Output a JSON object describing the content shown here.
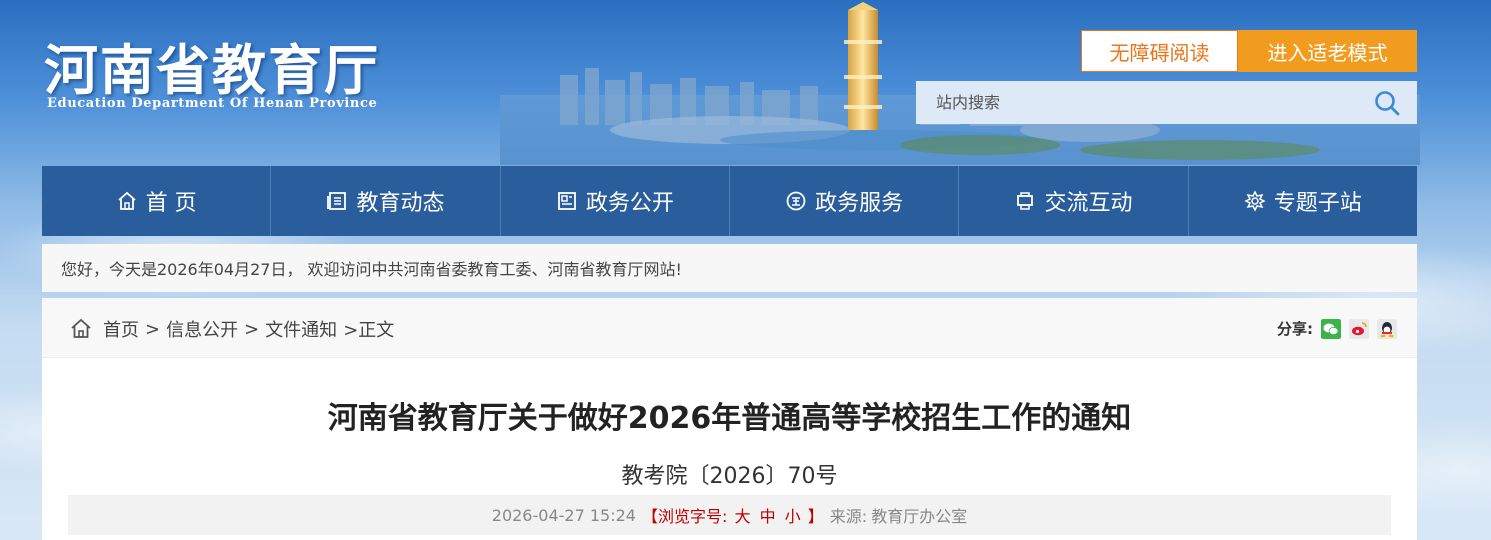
{
  "header": {
    "logo_cn": "河南省教育厅",
    "logo_en": "Education Department Of Henan Province",
    "btn_accessible": "无障碍阅读",
    "btn_elder": "进入适老模式",
    "search_placeholder": "站内搜索"
  },
  "nav": {
    "items": [
      {
        "label": "首 页",
        "icon": "home-icon"
      },
      {
        "label": "教育动态",
        "icon": "news-icon"
      },
      {
        "label": "政务公开",
        "icon": "document-icon"
      },
      {
        "label": "政务服务",
        "icon": "service-icon"
      },
      {
        "label": "交流互动",
        "icon": "interact-icon"
      },
      {
        "label": "专题子站",
        "icon": "subsite-icon"
      }
    ]
  },
  "welcome_text": "您好，今天是2026年04月27日， 欢迎访问中共河南省委教育工委、河南省教育厅网站!",
  "breadcrumb": {
    "home": "首页",
    "sep": ">",
    "level1": "信息公开",
    "level2": "文件通知",
    "current": ">正文"
  },
  "share_label": "分享:",
  "article": {
    "title": "河南省教育厅关于做好2026年普通高等学校招生工作的通知",
    "doc_number": "教考院〔2026〕70号",
    "datetime": "2026-04-27 15:24",
    "font_size_prefix": "【浏览字号:",
    "size_large": "大",
    "size_medium": "中",
    "size_small": "小",
    "font_size_suffix": "】",
    "source_label": "来源:",
    "source": "教育厅办公室"
  },
  "colors": {
    "nav_bg": "#2a5d9c",
    "accent_orange": "#f29c1f",
    "font_ctrl_red": "#c00000"
  }
}
